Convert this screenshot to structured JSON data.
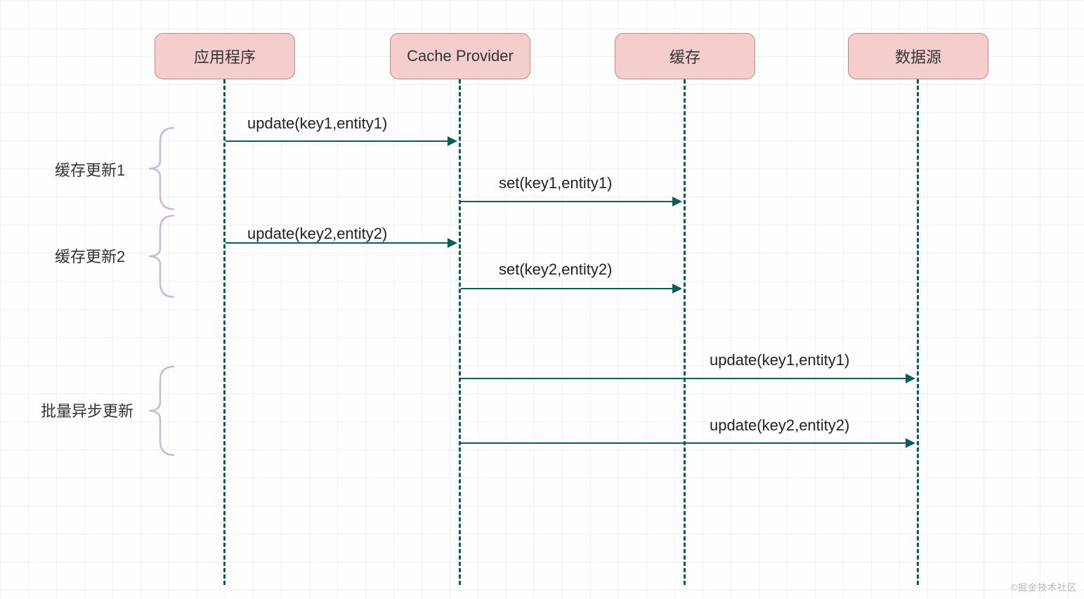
{
  "participants": {
    "app": "应用程序",
    "cacheProvider": "Cache Provider",
    "cache": "缓存",
    "datasource": "数据源"
  },
  "groups": {
    "update1": "缓存更新1",
    "update2": "缓存更新2",
    "batch": "批量异步更新"
  },
  "messages": {
    "m1": "update(key1,entity1)",
    "m2": "set(key1,entity1)",
    "m3": "update(key2,entity2)",
    "m4": "set(key2,entity2)",
    "m5": "update(key1,entity1)",
    "m6": "update(key2,entity2)"
  },
  "watermark": "©掘金技术社区"
}
